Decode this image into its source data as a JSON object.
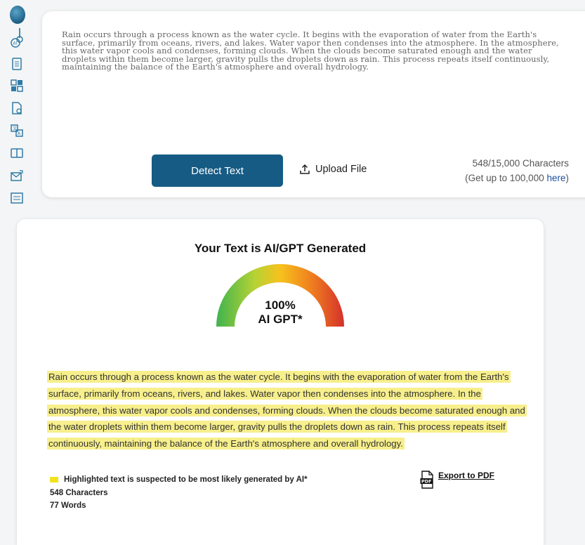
{
  "sidebar": {
    "items": [
      {
        "icon": "brand-logo-icon"
      },
      {
        "icon": "ai-chat-icon"
      },
      {
        "icon": "document-list-icon"
      },
      {
        "icon": "grid-qr-icon"
      },
      {
        "icon": "document-edit-icon"
      },
      {
        "icon": "translate-icon"
      },
      {
        "icon": "compare-icon"
      },
      {
        "icon": "mail-send-icon"
      },
      {
        "icon": "image-layout-icon"
      }
    ]
  },
  "input": {
    "text": "Rain occurs through a process known as the water cycle. It begins with the evaporation of water from the Earth's surface, primarily from oceans, rivers, and lakes. Water vapor then condenses into the atmosphere. In the atmosphere, this water vapor cools and condenses, forming clouds. When the clouds become saturated enough and the water droplets within them become larger, gravity pulls the droplets down as rain. This process repeats itself continuously, maintaining the balance of the Earth's atmosphere and overall hydrology.",
    "detect_button": "Detect Text",
    "upload_label": "Upload File",
    "char_count": "548/15,000 Characters",
    "upgrade_prefix": "(Get up to 100,000 ",
    "upgrade_link": "here",
    "upgrade_suffix": ")"
  },
  "result": {
    "title": "Your Text is AI/GPT Generated",
    "gauge_percent": "100%",
    "gauge_caption": "AI GPT*",
    "gauge_value": 1.0,
    "highlighted_text": "Rain occurs through a process known as the water cycle. It begins with the evaporation of water from the Earth's surface, primarily from oceans, rivers, and lakes. Water vapor then condenses into the atmosphere. In the atmosphere, this water vapor cools and condenses, forming clouds. When the clouds become saturated enough and the water droplets within them become larger, gravity pulls the droplets down as rain. This process repeats itself continuously, maintaining the balance of the Earth's atmosphere and overall hydrology.",
    "legend_text": "Highlighted text is suspected to be most likely generated by AI*",
    "characters": "548 Characters",
    "words": "77 Words",
    "export_label": "Export to PDF"
  },
  "colors": {
    "primary_button": "#165b84",
    "highlight": "#f7ef8c",
    "legend_swatch": "#f2e21c",
    "link": "#1e4f9c"
  }
}
